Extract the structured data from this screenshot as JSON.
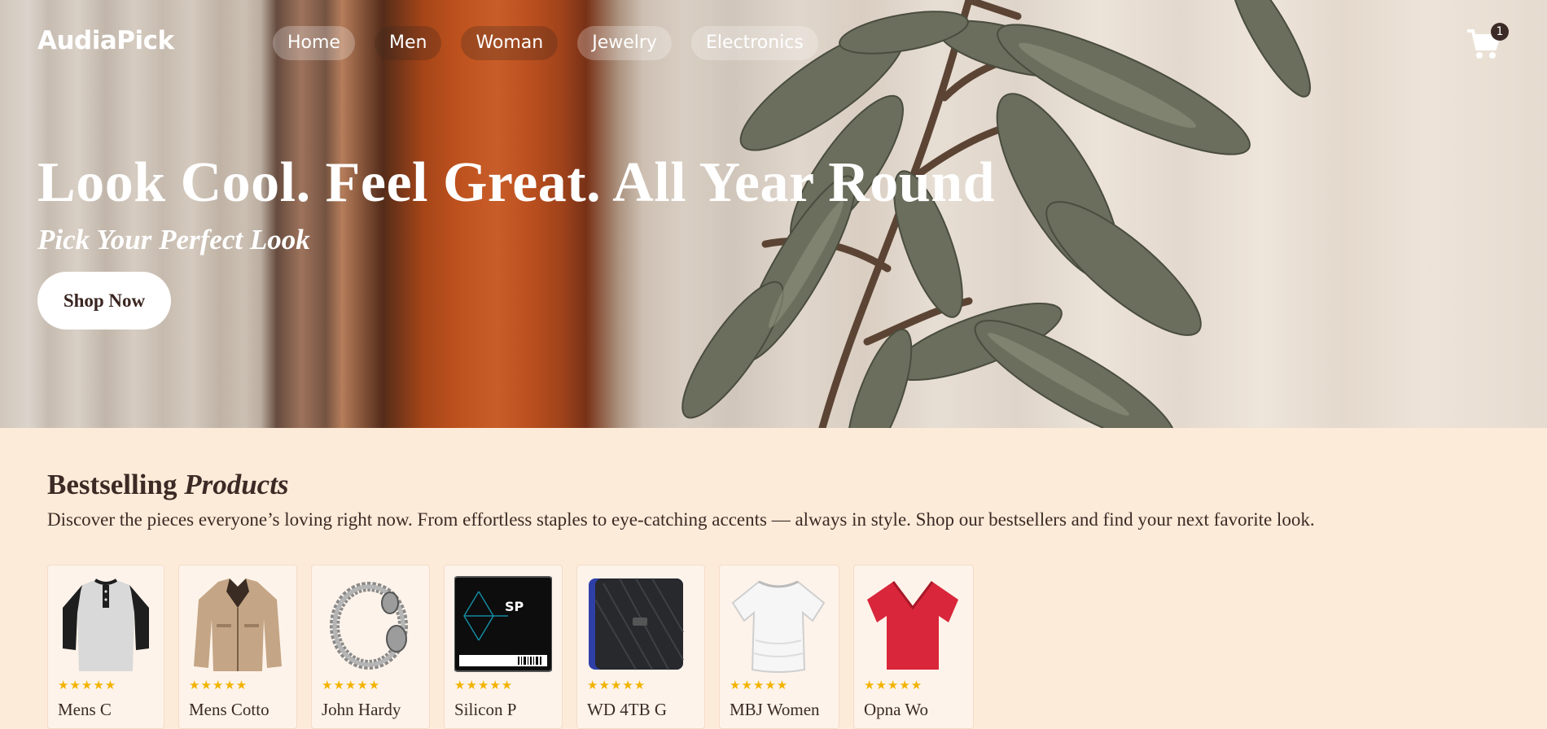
{
  "brand": "AudiaPick",
  "nav": [
    {
      "label": "Home"
    },
    {
      "label": "Men"
    },
    {
      "label": "Woman"
    },
    {
      "label": "Jewelry"
    },
    {
      "label": "Electronics"
    }
  ],
  "cart": {
    "count": "1",
    "icon": "cart-icon"
  },
  "hero": {
    "title": "Look Cool. Feel Great. All Year Round",
    "subtitle": "Pick Your Perfect Look",
    "cta": "Shop Now"
  },
  "bestselling": {
    "title_plain": "Bestselling",
    "title_italic": "Products",
    "description": "Discover the pieces everyone’s loving right now. From effortless staples to eye-catching accents — always in style. Shop our bestsellers and find your next favorite look."
  },
  "products": [
    {
      "name": "Mens C",
      "stars": "★★★★★",
      "image": "raglan-henley-shirt"
    },
    {
      "name": "Mens Cotto",
      "stars": "★★★★★",
      "image": "beige-jacket"
    },
    {
      "name": "John Hardy",
      "stars": "★★★★★",
      "image": "silver-dragon-bracelet"
    },
    {
      "name": "Silicon P",
      "stars": "★★★★★",
      "image": "sp-ssd-drive"
    },
    {
      "name": "WD 4TB G",
      "stars": "★★★★★",
      "image": "wd-external-hard-drive"
    },
    {
      "name": "MBJ Women",
      "stars": "★★★★★",
      "image": "white-tshirt"
    },
    {
      "name": "Opna Wo",
      "stars": "★★★★★",
      "image": "red-vneck-tshirt"
    }
  ],
  "colors": {
    "page_bg": "#fdebd9",
    "text_dark": "#3b2a25",
    "star": "#f2b300",
    "orange_fabric": "#c9561f"
  }
}
